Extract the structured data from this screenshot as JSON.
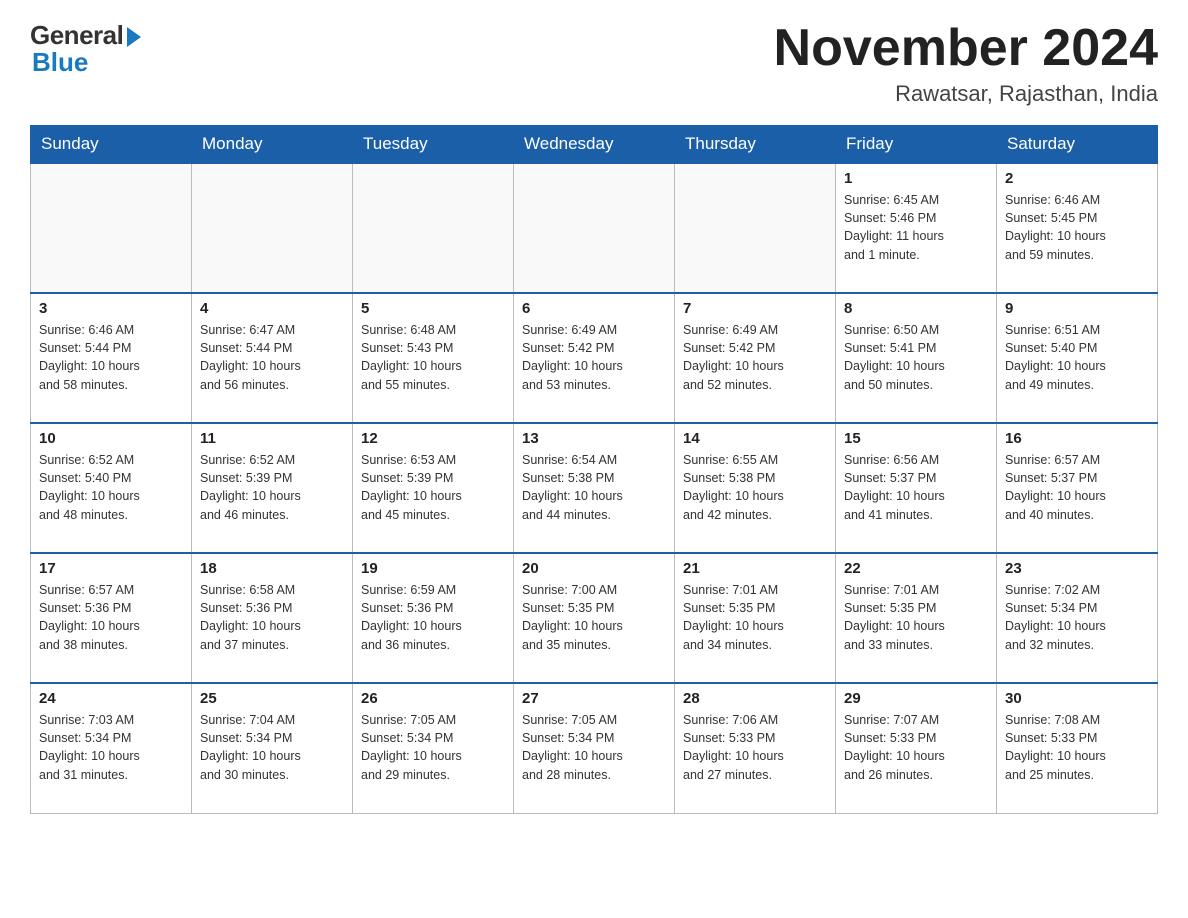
{
  "header": {
    "logo_general": "General",
    "logo_blue": "Blue",
    "month_title": "November 2024",
    "location": "Rawatsar, Rajasthan, India"
  },
  "weekdays": [
    "Sunday",
    "Monday",
    "Tuesday",
    "Wednesday",
    "Thursday",
    "Friday",
    "Saturday"
  ],
  "weeks": [
    [
      {
        "day": "",
        "info": ""
      },
      {
        "day": "",
        "info": ""
      },
      {
        "day": "",
        "info": ""
      },
      {
        "day": "",
        "info": ""
      },
      {
        "day": "",
        "info": ""
      },
      {
        "day": "1",
        "info": "Sunrise: 6:45 AM\nSunset: 5:46 PM\nDaylight: 11 hours\nand 1 minute."
      },
      {
        "day": "2",
        "info": "Sunrise: 6:46 AM\nSunset: 5:45 PM\nDaylight: 10 hours\nand 59 minutes."
      }
    ],
    [
      {
        "day": "3",
        "info": "Sunrise: 6:46 AM\nSunset: 5:44 PM\nDaylight: 10 hours\nand 58 minutes."
      },
      {
        "day": "4",
        "info": "Sunrise: 6:47 AM\nSunset: 5:44 PM\nDaylight: 10 hours\nand 56 minutes."
      },
      {
        "day": "5",
        "info": "Sunrise: 6:48 AM\nSunset: 5:43 PM\nDaylight: 10 hours\nand 55 minutes."
      },
      {
        "day": "6",
        "info": "Sunrise: 6:49 AM\nSunset: 5:42 PM\nDaylight: 10 hours\nand 53 minutes."
      },
      {
        "day": "7",
        "info": "Sunrise: 6:49 AM\nSunset: 5:42 PM\nDaylight: 10 hours\nand 52 minutes."
      },
      {
        "day": "8",
        "info": "Sunrise: 6:50 AM\nSunset: 5:41 PM\nDaylight: 10 hours\nand 50 minutes."
      },
      {
        "day": "9",
        "info": "Sunrise: 6:51 AM\nSunset: 5:40 PM\nDaylight: 10 hours\nand 49 minutes."
      }
    ],
    [
      {
        "day": "10",
        "info": "Sunrise: 6:52 AM\nSunset: 5:40 PM\nDaylight: 10 hours\nand 48 minutes."
      },
      {
        "day": "11",
        "info": "Sunrise: 6:52 AM\nSunset: 5:39 PM\nDaylight: 10 hours\nand 46 minutes."
      },
      {
        "day": "12",
        "info": "Sunrise: 6:53 AM\nSunset: 5:39 PM\nDaylight: 10 hours\nand 45 minutes."
      },
      {
        "day": "13",
        "info": "Sunrise: 6:54 AM\nSunset: 5:38 PM\nDaylight: 10 hours\nand 44 minutes."
      },
      {
        "day": "14",
        "info": "Sunrise: 6:55 AM\nSunset: 5:38 PM\nDaylight: 10 hours\nand 42 minutes."
      },
      {
        "day": "15",
        "info": "Sunrise: 6:56 AM\nSunset: 5:37 PM\nDaylight: 10 hours\nand 41 minutes."
      },
      {
        "day": "16",
        "info": "Sunrise: 6:57 AM\nSunset: 5:37 PM\nDaylight: 10 hours\nand 40 minutes."
      }
    ],
    [
      {
        "day": "17",
        "info": "Sunrise: 6:57 AM\nSunset: 5:36 PM\nDaylight: 10 hours\nand 38 minutes."
      },
      {
        "day": "18",
        "info": "Sunrise: 6:58 AM\nSunset: 5:36 PM\nDaylight: 10 hours\nand 37 minutes."
      },
      {
        "day": "19",
        "info": "Sunrise: 6:59 AM\nSunset: 5:36 PM\nDaylight: 10 hours\nand 36 minutes."
      },
      {
        "day": "20",
        "info": "Sunrise: 7:00 AM\nSunset: 5:35 PM\nDaylight: 10 hours\nand 35 minutes."
      },
      {
        "day": "21",
        "info": "Sunrise: 7:01 AM\nSunset: 5:35 PM\nDaylight: 10 hours\nand 34 minutes."
      },
      {
        "day": "22",
        "info": "Sunrise: 7:01 AM\nSunset: 5:35 PM\nDaylight: 10 hours\nand 33 minutes."
      },
      {
        "day": "23",
        "info": "Sunrise: 7:02 AM\nSunset: 5:34 PM\nDaylight: 10 hours\nand 32 minutes."
      }
    ],
    [
      {
        "day": "24",
        "info": "Sunrise: 7:03 AM\nSunset: 5:34 PM\nDaylight: 10 hours\nand 31 minutes."
      },
      {
        "day": "25",
        "info": "Sunrise: 7:04 AM\nSunset: 5:34 PM\nDaylight: 10 hours\nand 30 minutes."
      },
      {
        "day": "26",
        "info": "Sunrise: 7:05 AM\nSunset: 5:34 PM\nDaylight: 10 hours\nand 29 minutes."
      },
      {
        "day": "27",
        "info": "Sunrise: 7:05 AM\nSunset: 5:34 PM\nDaylight: 10 hours\nand 28 minutes."
      },
      {
        "day": "28",
        "info": "Sunrise: 7:06 AM\nSunset: 5:33 PM\nDaylight: 10 hours\nand 27 minutes."
      },
      {
        "day": "29",
        "info": "Sunrise: 7:07 AM\nSunset: 5:33 PM\nDaylight: 10 hours\nand 26 minutes."
      },
      {
        "day": "30",
        "info": "Sunrise: 7:08 AM\nSunset: 5:33 PM\nDaylight: 10 hours\nand 25 minutes."
      }
    ]
  ]
}
